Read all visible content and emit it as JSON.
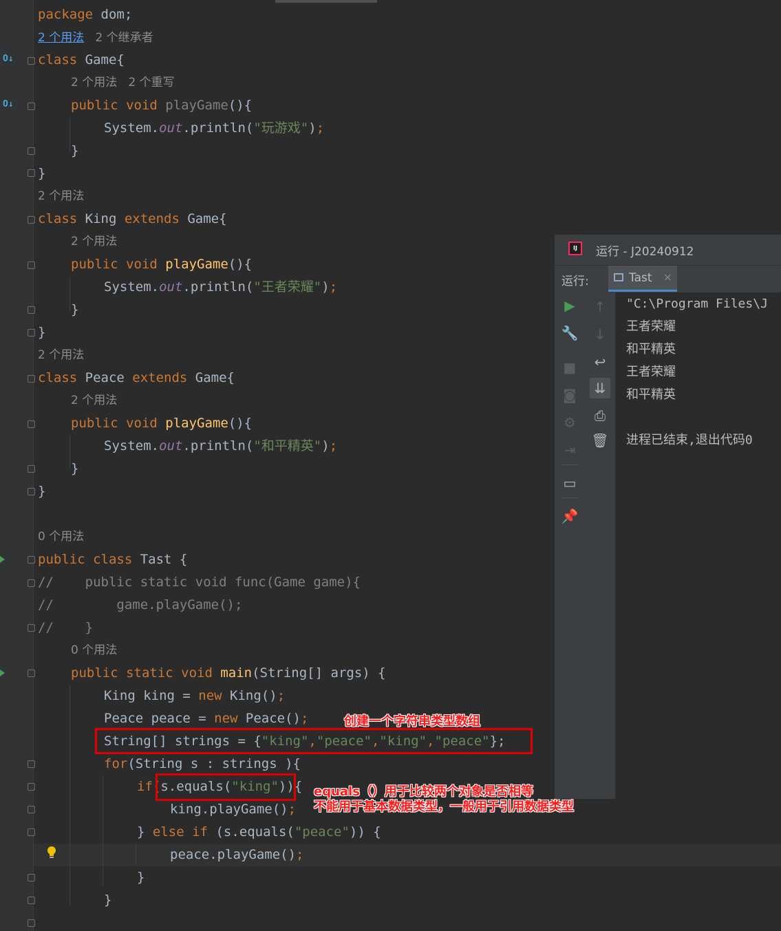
{
  "editor": {
    "hints": {
      "usage_link": "2 个用法",
      "inheritors": "2 个继承者",
      "usages_overrides_1": "2 个用法",
      "usages_overrides_2": "2 个重写",
      "usages_2": "2 个用法",
      "usages_0": "0 个用法"
    },
    "code": {
      "l01_kw": "package",
      "l01_rest": " dom;",
      "l03_kw": "class",
      "l03_rest": " Game{",
      "l05_kw": "public void",
      "l05_fn": " playGame",
      "l05_rest": "(){",
      "l06_a": "System.",
      "l06_out": "out",
      "l06_b": ".println(",
      "l06_str": "\"玩游戏\"",
      "l06_c": ")",
      "l06_semi": ";",
      "close_brace": "}",
      "l10_kw1": "class",
      "l10_mid": " King ",
      "l10_kw2": "extends",
      "l10_rest": " Game{",
      "l13_str": "\"王者荣耀\"",
      "l17_kw1": "class",
      "l17_mid": " Peace ",
      "l17_kw2": "extends",
      "l17_rest": " Game{",
      "l20_str": "\"和平精英\"",
      "l25_kw": "public class",
      "l25_name": " Tast",
      "l25_rest": " {",
      "l26": "//    public static void func(Game game){",
      "l27": "//        game.playGame();",
      "l28": "//    }",
      "l30_kw": "public static void",
      "l30_fn": " main",
      "l30_rest": "(String[] args) {",
      "l31_a": "King king = ",
      "l31_kw": "new",
      "l31_b": " King()",
      "l31_semi": ";",
      "l32_a": "Peace peace = ",
      "l32_kw": "new",
      "l32_b": " Peace()",
      "l32_semi": ";",
      "l33_a": "String[] strings = {",
      "l33_s1": "\"king\"",
      "l33_c1": ",",
      "l33_s2": "\"peace\"",
      "l33_c2": ",",
      "l33_s3": "\"king\"",
      "l33_c3": ",",
      "l33_s4": "\"peace\"",
      "l33_b": "};",
      "l34_kw": "for",
      "l34_rest": "(String s : strings ){",
      "l35_kw": "if",
      "l35_a": "(s.equals(",
      "l35_str": "\"king\"",
      "l35_b": ")){",
      "l36_a": "king.playGame()",
      "l36_semi": ";",
      "l37_a": "} ",
      "l37_kw1": "else",
      "l37_sp": " ",
      "l37_kw2": "if",
      "l37_b": " (s.equals(",
      "l37_str": "\"peace\"",
      "l37_c": ")) {",
      "l38_a": "peace.playGame()",
      "l38_semi": ";"
    },
    "annotations": {
      "array_note": "创建一个字符串类型数组",
      "equals_note_1": "equals（）用于比较两个对象是否相等",
      "equals_note_2": "不能用于基本数据类型，一般用于引用数据类型"
    }
  },
  "run_panel": {
    "title": "运行 - J20240912",
    "run_label": "运行:",
    "tab_name": "Tast",
    "console_lines": [
      "\"C:\\Program Files\\J",
      "王者荣耀",
      "和平精英",
      "王者荣耀",
      "和平精英",
      "",
      "进程已结束,退出代码0"
    ],
    "icons": [
      "run-icon",
      "wrench-icon",
      "stop-icon",
      "camera-icon",
      "settings-icon",
      "login-icon",
      "layout-icon",
      "pin-icon",
      "up-arrow-icon",
      "down-arrow-icon",
      "soft-wrap-icon",
      "scroll-to-end-icon",
      "print-icon",
      "trash-icon"
    ]
  }
}
